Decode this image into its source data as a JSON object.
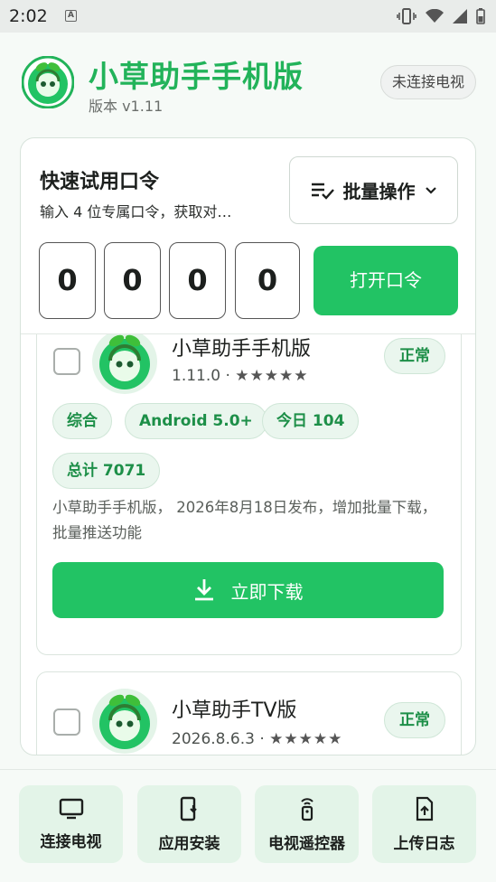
{
  "status_bar": {
    "time": "2:02",
    "notification_letter": "A"
  },
  "header": {
    "title": "小草助手手机版",
    "version": "版本 v1.11",
    "tv_status": "未连接电视"
  },
  "quick": {
    "title": "快速试用口令",
    "description": "输入 4 位专属口令，获取对…",
    "batch_label": "批量操作",
    "code_digits": [
      "0",
      "0",
      "0",
      "0"
    ],
    "open_label": "打开口令"
  },
  "apps": [
    {
      "name": "小草助手手机版",
      "version": "1.11.0",
      "rating": "★★★★★",
      "status": "正常",
      "tags": [
        "综合",
        "Android 5.0+",
        "今日 104",
        "总计 7071"
      ],
      "description": "小草助手手机版， 2026年8月18日发布，增加批量下载，批量推送功能",
      "download_label": "立即下载"
    },
    {
      "name": "小草助手TV版",
      "version": "2026.8.6.3",
      "rating": "★★★★★",
      "status": "正常"
    }
  ],
  "bottom_nav": [
    {
      "label": "连接电视",
      "icon": "tv-icon"
    },
    {
      "label": "应用安装",
      "icon": "phone-install-icon"
    },
    {
      "label": "电视遥控器",
      "icon": "remote-icon"
    },
    {
      "label": "上传日志",
      "icon": "upload-file-icon"
    }
  ],
  "colors": {
    "accent": "#22c364",
    "title_green": "#22b35a",
    "tag_text": "#1d8f48",
    "tag_bg": "#eaf6ee"
  }
}
